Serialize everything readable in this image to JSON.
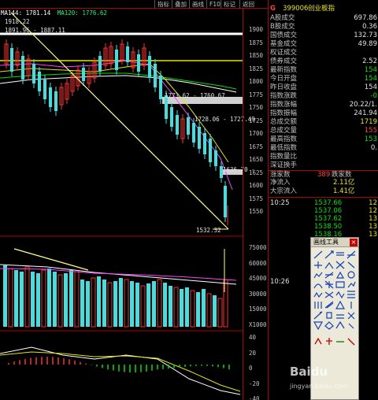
{
  "toolbar": {
    "buttons": [
      "指标",
      "叠加",
      "画线",
      "F10",
      "标记",
      "返回"
    ]
  },
  "chart": {
    "ma_labels": {
      "ma144": "MA144: 1781.14",
      "ma120": "MA120: 1776.62"
    },
    "price_top": "1918.22",
    "range_top": "1891.96 - 1887.11",
    "range_mid": "1773.62 - 1760.67",
    "range_low": "1728.06 - 1727.49",
    "range_bot": "1636.70 -",
    "low_price": "1532.32",
    "y_ticks_price": [
      "1900",
      "1875",
      "1850",
      "1825",
      "1800",
      "1775",
      "1750",
      "1725",
      "1700",
      "1675",
      "1650",
      "1625",
      "1600",
      "1575",
      "1550"
    ],
    "y_ticks_volume": [
      "75000",
      "60000",
      "45000",
      "30000",
      "15000",
      "X1000"
    ],
    "y_ticks_macd": [
      "40",
      "20",
      "0",
      "-20",
      "-40"
    ]
  },
  "panel": {
    "code": "399006",
    "name": "创业板指",
    "indicator_label": "G",
    "rows": [
      {
        "label": "A股成交",
        "value": "697.86",
        "color": "white"
      },
      {
        "label": "B股成交",
        "value": "0.36",
        "color": "white"
      },
      {
        "label": "国债成交",
        "value": "132.73",
        "color": "white"
      },
      {
        "label": "基金成交",
        "value": "49.89",
        "color": "white"
      },
      {
        "label": "权证成交",
        "value": "",
        "color": "white"
      },
      {
        "label": "债券成交",
        "value": "2.52",
        "color": "white"
      },
      {
        "label": "最新指数",
        "value": "154",
        "color": "green"
      },
      {
        "label": "今日开盘",
        "value": "154",
        "color": "green"
      },
      {
        "label": "昨日收盘",
        "value": "154",
        "color": "white"
      },
      {
        "label": "指数涨跌",
        "value": "-0",
        "color": "green"
      },
      {
        "label": "指数涨幅",
        "value": "20.22/1.",
        "color": "white"
      },
      {
        "label": "指数振幅",
        "value": "241.94",
        "color": "white"
      },
      {
        "label": "总成交额",
        "value": "1719",
        "color": "yellow"
      },
      {
        "label": "总成交量",
        "value": "155",
        "color": "red"
      },
      {
        "label": "最高指数",
        "value": "153",
        "color": "green"
      },
      {
        "label": "最低指数",
        "value": "0.",
        "color": "white"
      },
      {
        "label": "指数量比",
        "value": "",
        "color": "white"
      },
      {
        "label": "深证换手",
        "value": "",
        "color": "white"
      }
    ],
    "up_label": "涨家数",
    "up_count": "389",
    "down_label": "跌家数",
    "net_in_label": "净流入",
    "net_in_value": "2.11亿",
    "big_in_label": "大宗流入",
    "big_in_value": "1.41亿",
    "ticks": [
      {
        "time": "10:25",
        "price": "1537.66",
        "vol": "12"
      },
      {
        "time": "",
        "price": "1537.06",
        "vol": "12"
      },
      {
        "time": "",
        "price": "1537.62",
        "vol": "13"
      },
      {
        "time": "",
        "price": "1538.50",
        "vol": "13"
      },
      {
        "time": "",
        "price": "1538.16",
        "vol": "13"
      }
    ],
    "time2": "10:26"
  },
  "toolbox": {
    "title": "画线工具",
    "close": "×"
  },
  "watermark": {
    "line1": "Baidu",
    "line2": "jingyan.baidu.com"
  }
}
